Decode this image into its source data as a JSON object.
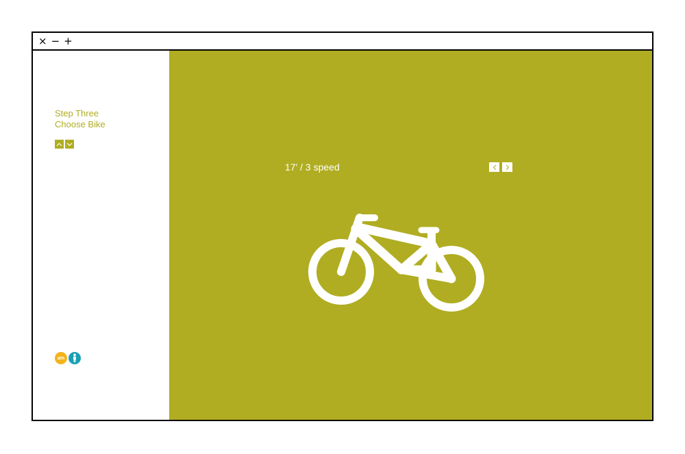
{
  "window": {
    "controls": {
      "close": "×",
      "minimize": "−",
      "maximize": "+"
    }
  },
  "sidebar": {
    "step_line1": "Step Three",
    "step_line2": "Choose Bike",
    "badges": {
      "am_label": "am"
    }
  },
  "main": {
    "bike_label": "17' / 3 speed"
  },
  "icons": {
    "step_up": "chevron-up-icon",
    "step_down": "chevron-down-icon",
    "prev": "chevron-left-icon",
    "next": "chevron-right-icon",
    "bike": "bicycle-icon",
    "person": "person-icon"
  },
  "colors": {
    "accent": "#b0ad22",
    "badge_am": "#f2b41c",
    "badge_person": "#1aa0b4",
    "foreground": "#ffffff"
  }
}
